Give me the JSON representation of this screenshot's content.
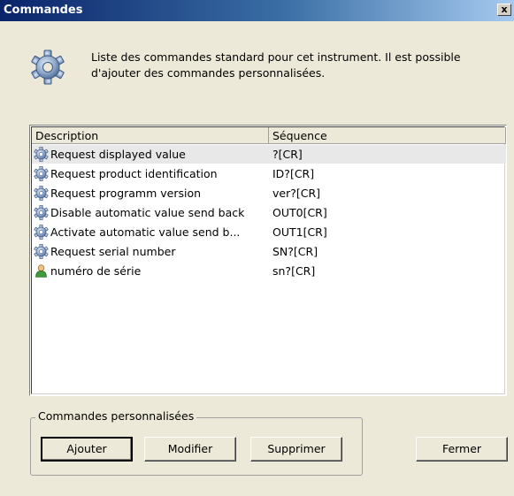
{
  "window": {
    "title": "Commandes",
    "close_label": "x"
  },
  "header": {
    "icon": "gear-icon",
    "description": "Liste des commandes standard pour cet instrument. Il est possible d'ajouter des commandes personnalisées."
  },
  "table": {
    "columns": [
      "Description",
      "Séquence"
    ],
    "rows": [
      {
        "icon": "gear-icon",
        "description": "Request displayed value",
        "sequence": "?[CR]"
      },
      {
        "icon": "gear-icon",
        "description": "Request product identification",
        "sequence": "ID?[CR]"
      },
      {
        "icon": "gear-icon",
        "description": "Request programm version",
        "sequence": "ver?[CR]"
      },
      {
        "icon": "gear-icon",
        "description": "Disable automatic value send back",
        "sequence": "OUT0[CR]"
      },
      {
        "icon": "gear-icon",
        "description": "Activate automatic value send b...",
        "sequence": "OUT1[CR]"
      },
      {
        "icon": "gear-icon",
        "description": "Request serial number",
        "sequence": "SN?[CR]"
      },
      {
        "icon": "user-icon",
        "description": "numéro de série",
        "sequence": "sn?[CR]"
      }
    ]
  },
  "custom_commands": {
    "group_label": "Commandes personnalisées",
    "add_label": "Ajouter",
    "edit_label": "Modifier",
    "delete_label": "Supprimer"
  },
  "footer": {
    "close_label": "Fermer"
  }
}
